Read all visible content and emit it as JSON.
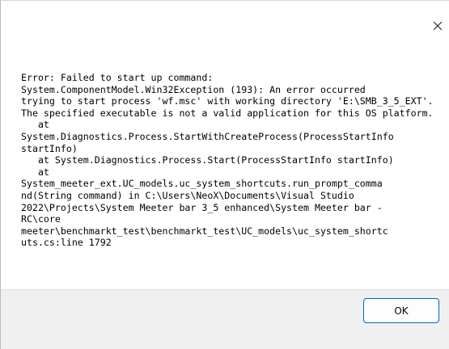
{
  "dialog": {
    "close_icon": "close-icon",
    "message_lines": [
      "Error: Failed to start up command:",
      "System.ComponentModel.Win32Exception (193): An error occurred",
      "trying to start process 'wf.msc' with working directory 'E:\\SMB_3_5_EXT'.",
      "The specified executable is not a valid application for this OS platform.",
      "   at",
      "System.Diagnostics.Process.StartWithCreateProcess(ProcessStartInfo",
      "startInfo)",
      "   at System.Diagnostics.Process.Start(ProcessStartInfo startInfo)",
      "   at",
      "System_meeter_ext.UC_models.uc_system_shortcuts.run_prompt_comma",
      "nd(String command) in C:\\Users\\NeoX\\Documents\\Visual Studio",
      "2022\\Projects\\System Meeter bar 3_5 enhanced\\System Meeter bar -",
      "RC\\core",
      "meeter\\benchmarkt_test\\benchmarkt_test\\UC_models\\uc_system_shortc",
      "uts.cs:line 1792"
    ],
    "ok_label": "OK",
    "accent_color": "#0067c0"
  }
}
